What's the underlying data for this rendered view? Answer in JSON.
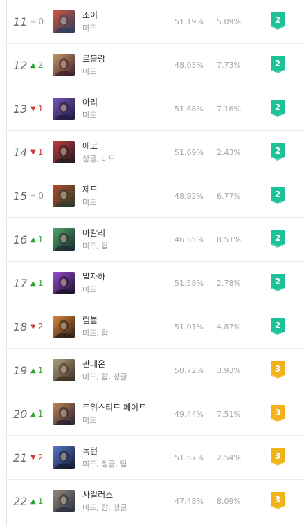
{
  "rows": [
    {
      "rank": "11",
      "change": "0",
      "dir": "same",
      "name": "조이",
      "positions": "미드",
      "win_rate": "51.19%",
      "pick_rate": "5.09%",
      "tier": "2",
      "portrait": "zoe-portrait",
      "c1": "#d8563a",
      "c2": "#2a3c5c"
    },
    {
      "rank": "12",
      "change": "2",
      "dir": "up",
      "name": "르블랑",
      "positions": "미드",
      "win_rate": "48.05%",
      "pick_rate": "7.73%",
      "tier": "2",
      "portrait": "leblanc-portrait",
      "c1": "#c89a6a",
      "c2": "#3a1c2a"
    },
    {
      "rank": "13",
      "change": "1",
      "dir": "down",
      "name": "아리",
      "positions": "미드",
      "win_rate": "51.68%",
      "pick_rate": "7.16%",
      "tier": "2",
      "portrait": "ahri-portrait",
      "c1": "#7a56b8",
      "c2": "#1d1a3d"
    },
    {
      "rank": "14",
      "change": "1",
      "dir": "down",
      "name": "에코",
      "positions": "정글, 미드",
      "win_rate": "51.69%",
      "pick_rate": "2.43%",
      "tier": "2",
      "portrait": "ekko-portrait",
      "c1": "#c23c3c",
      "c2": "#1f1a24"
    },
    {
      "rank": "15",
      "change": "0",
      "dir": "same",
      "name": "제드",
      "positions": "미드",
      "win_rate": "48.92%",
      "pick_rate": "6.77%",
      "tier": "2",
      "portrait": "zed-portrait",
      "c1": "#b34a2a",
      "c2": "#2b3a2f"
    },
    {
      "rank": "16",
      "change": "1",
      "dir": "up",
      "name": "아칼리",
      "positions": "미드, 탑",
      "win_rate": "46.55%",
      "pick_rate": "8.51%",
      "tier": "2",
      "portrait": "akali-portrait",
      "c1": "#4fa76a",
      "c2": "#1b2630"
    },
    {
      "rank": "17",
      "change": "1",
      "dir": "up",
      "name": "말자하",
      "positions": "미드",
      "win_rate": "51.58%",
      "pick_rate": "2.78%",
      "tier": "2",
      "portrait": "malzahar-portrait",
      "c1": "#9a4fd0",
      "c2": "#17102a"
    },
    {
      "rank": "18",
      "change": "2",
      "dir": "down",
      "name": "럼블",
      "positions": "미드, 탑",
      "win_rate": "51.01%",
      "pick_rate": "4.87%",
      "tier": "2",
      "portrait": "rumble-portrait",
      "c1": "#e08a3a",
      "c2": "#2a1e18"
    },
    {
      "rank": "19",
      "change": "1",
      "dir": "up",
      "name": "판테온",
      "positions": "미드, 탑, 정글",
      "win_rate": "50.72%",
      "pick_rate": "3.93%",
      "tier": "3",
      "portrait": "pantheon-portrait",
      "c1": "#b0a080",
      "c2": "#3a2c22"
    },
    {
      "rank": "20",
      "change": "1",
      "dir": "up",
      "name": "트위스티드 페이트",
      "positions": "미드",
      "win_rate": "49.44%",
      "pick_rate": "7.51%",
      "tier": "3",
      "portrait": "twisted-fate-portrait",
      "c1": "#c08a52",
      "c2": "#2a2030"
    },
    {
      "rank": "21",
      "change": "2",
      "dir": "down",
      "name": "녹턴",
      "positions": "미드, 정글, 탑",
      "win_rate": "51.57%",
      "pick_rate": "2.54%",
      "tier": "3",
      "portrait": "nocturne-portrait",
      "c1": "#5a78c8",
      "c2": "#121a2e"
    },
    {
      "rank": "22",
      "change": "1",
      "dir": "up",
      "name": "사일러스",
      "positions": "미드, 탑, 정글",
      "win_rate": "47.48%",
      "pick_rate": "8.09%",
      "tier": "3",
      "portrait": "sylas-portrait",
      "c1": "#9a8a78",
      "c2": "#263040"
    }
  ],
  "colors": {
    "tier_2": "#1dc29b",
    "tier_3": "#f2b318",
    "up": "#2da32d",
    "down": "#d23a3a",
    "same": "#9a9a9a"
  }
}
